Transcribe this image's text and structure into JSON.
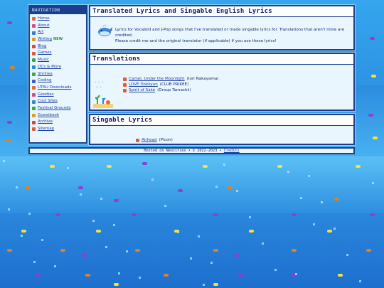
{
  "nav": {
    "heading": "NAVIGATION",
    "items": [
      {
        "label": "Home",
        "color": "#e06a3a"
      },
      {
        "label": "About",
        "color": "#d94a8c"
      },
      {
        "label": "Art",
        "color": "#3a7ad9"
      },
      {
        "label": "Writing",
        "color": "#e09a2a",
        "badge": "NEW"
      },
      {
        "label": "Blog",
        "color": "#d9443a"
      },
      {
        "label": "Games",
        "color": "#e05a3a"
      },
      {
        "label": "Music",
        "color": "#3aa84a"
      },
      {
        "label": "OCs & More",
        "color": "#2a8ad9"
      },
      {
        "label": "Shrines",
        "color": "#3aa84a"
      },
      {
        "label": "Coding",
        "color": "#3a5ad9"
      },
      {
        "label": "UTAU Downloads",
        "color": "#e06a3a"
      },
      {
        "label": "Goodies",
        "color": "#d94a8c"
      },
      {
        "label": "Cool Sites",
        "color": "#2a8ad9"
      },
      {
        "label": "Festival Grounds",
        "color": "#3aa84a"
      },
      {
        "label": "Guestbook",
        "color": "#e09a2a"
      },
      {
        "label": "Archive",
        "color": "#d9443a"
      },
      {
        "label": "Sitemap",
        "color": "#e05a3a"
      }
    ]
  },
  "intro": {
    "title": "Translated Lyrics and Singable English Lyrics",
    "line1": "Lyrics for Vocaloid and J-Pop songs that I've translated or made singable lyrics for. Translations that aren't mine are credited.",
    "line2": "Please credit me and the original translator (if applicable) if you use these lyrics!"
  },
  "translations": {
    "title": "Translations",
    "songs": [
      {
        "title": "Camel, Under the Moonlight",
        "credit": "(Iori Nakayama)"
      },
      {
        "title": "LOVE Dokkyun",
        "credit": "(CLUB PRIKEE)"
      },
      {
        "title": "Spirit of Saké",
        "credit": "(Group Tamashii)"
      }
    ]
  },
  "singable": {
    "title": "Singable Lyrics",
    "songs": [
      {
        "title": "Airhead",
        "credit": "(Picon)"
      }
    ]
  },
  "footer": {
    "text": "Hosted on Neocities • © 2022-2023 •",
    "credits_label": "Credits"
  },
  "colors": {
    "panel_border": "#1b3f8c",
    "panel_bg": "#eaf6fd",
    "link": "#1a3fa8",
    "new_badge": "#14a02a"
  }
}
